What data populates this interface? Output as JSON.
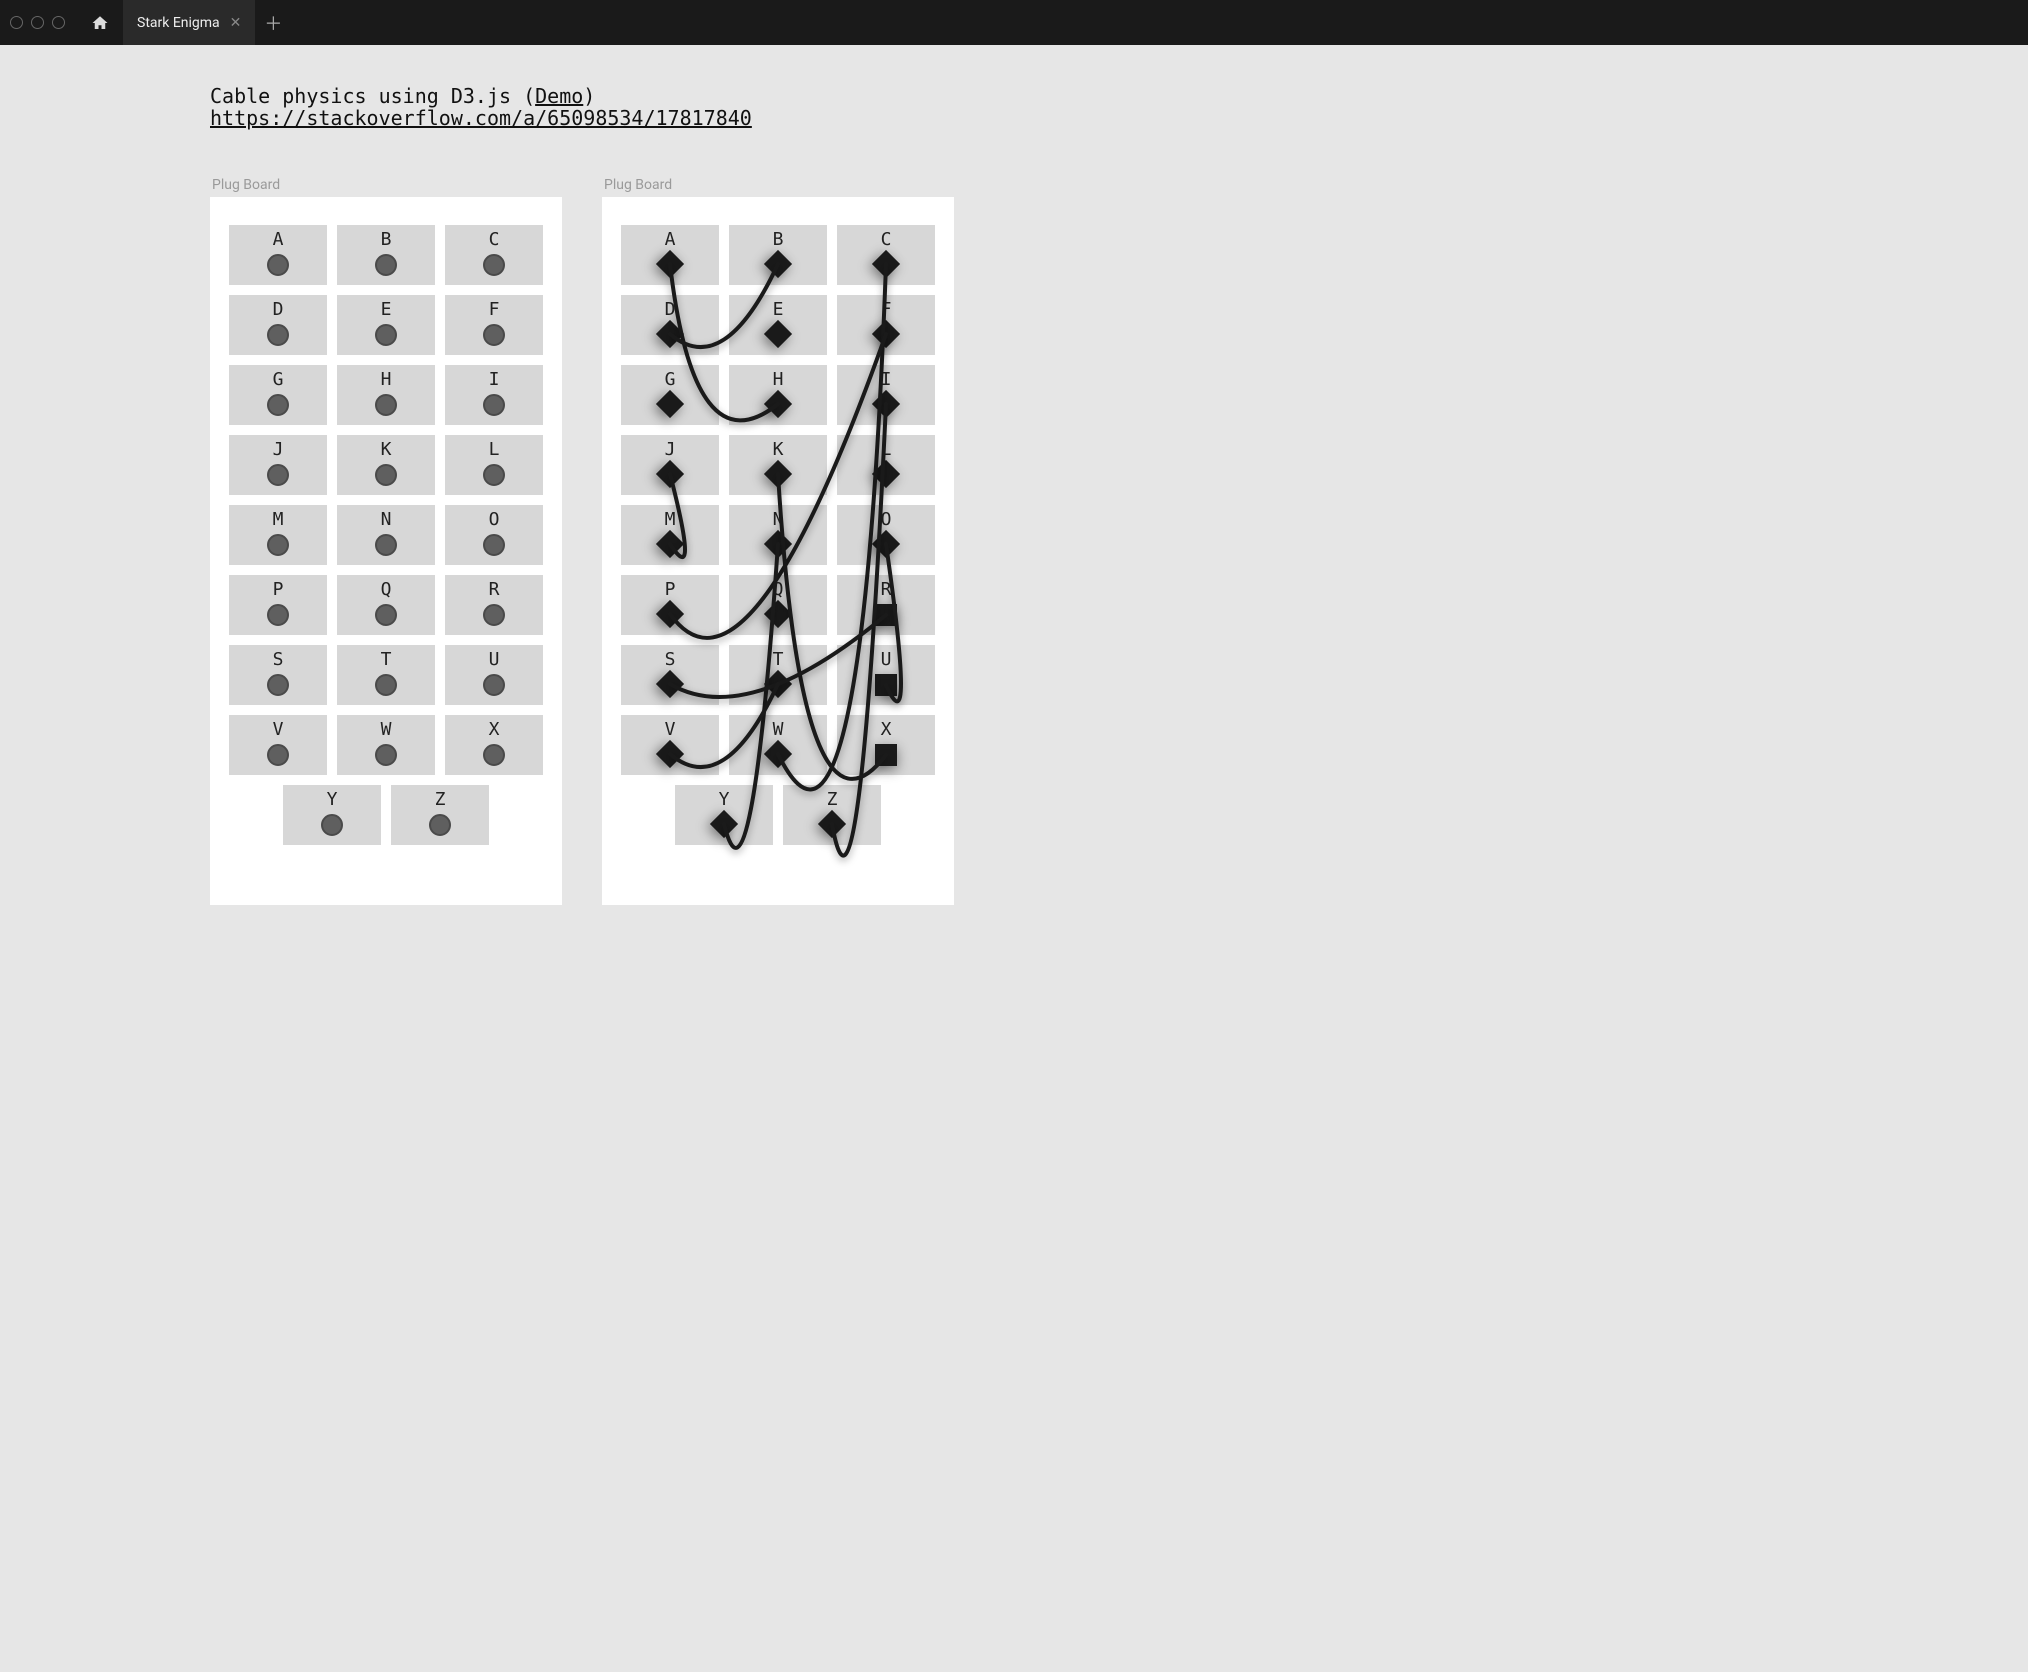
{
  "window": {
    "tab_title": "Stark Enigma"
  },
  "intro": {
    "line1_prefix": "Cable physics using D3.js (",
    "line1_link": "Demo",
    "line1_suffix": ")",
    "line2_link": "https://stackoverflow.com/a/65098534/17817840"
  },
  "board_label": "Plug Board",
  "letters": [
    "A",
    "B",
    "C",
    "D",
    "E",
    "F",
    "G",
    "H",
    "I",
    "J",
    "K",
    "L",
    "M",
    "N",
    "O",
    "P",
    "Q",
    "R",
    "S",
    "T",
    "U",
    "V",
    "W",
    "X",
    "Y",
    "Z"
  ],
  "right_plug_shapes": {
    "R": "square",
    "U": "square",
    "X": "square"
  },
  "right_cables": [
    [
      "A",
      "H"
    ],
    [
      "B",
      "D"
    ],
    [
      "C",
      "W"
    ],
    [
      "F",
      "P"
    ],
    [
      "I",
      "Z"
    ],
    [
      "J",
      "M"
    ],
    [
      "K",
      "X"
    ],
    [
      "N",
      "Y"
    ],
    [
      "O",
      "U"
    ],
    [
      "S",
      "R"
    ],
    [
      "T",
      "V"
    ]
  ]
}
